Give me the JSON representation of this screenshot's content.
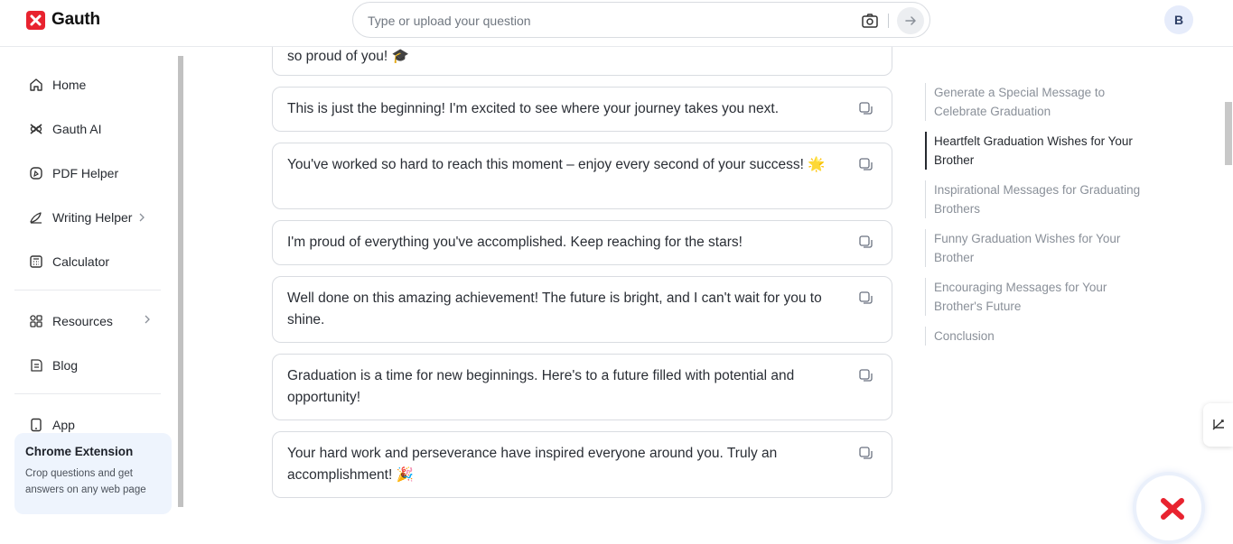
{
  "header": {
    "brand": "Gauth",
    "search_placeholder": "Type or upload your question",
    "avatar_initial": "B"
  },
  "sidebar": {
    "items": [
      {
        "label": "Home",
        "icon": "home-icon"
      },
      {
        "label": "Gauth AI",
        "icon": "gauth-ai-icon"
      },
      {
        "label": "PDF Helper",
        "icon": "pdf-icon"
      },
      {
        "label": "Writing Helper",
        "icon": "pen-icon"
      },
      {
        "label": "Calculator",
        "icon": "calculator-icon"
      },
      {
        "label": "Resources",
        "icon": "grid-icon"
      },
      {
        "label": "Blog",
        "icon": "blog-icon"
      },
      {
        "label": "App",
        "icon": "phone-icon"
      }
    ],
    "extension": {
      "title": "Chrome Extension",
      "description": "Crop questions and get answers on any web page"
    }
  },
  "messages": [
    {
      "text": "so proud of you! 🎓"
    },
    {
      "text": "This is just the beginning! I'm excited to see where your journey takes you next."
    },
    {
      "text": "You've worked so hard to reach this moment – enjoy every second of your success! 🌟"
    },
    {
      "text": "I'm proud of everything you've accomplished. Keep reaching for the stars!"
    },
    {
      "text": "Well done on this amazing achievement! The future is bright, and I can't wait for you to shine."
    },
    {
      "text": "Graduation is a time for new beginnings. Here's to a future filled with potential and opportunity!"
    },
    {
      "text": "Your hard work and perseverance have inspired everyone around you. Truly an accomplishment! 🎉"
    }
  ],
  "toc": [
    {
      "label": "Generate a Special Message to Celebrate Graduation",
      "active": false
    },
    {
      "label": "Heartfelt Graduation Wishes for Your Brother",
      "active": true
    },
    {
      "label": "Inspirational Messages for Graduating Brothers",
      "active": false
    },
    {
      "label": "Funny Graduation Wishes for Your Brother",
      "active": false
    },
    {
      "label": "Encouraging Messages for Your Brother's Future",
      "active": false
    },
    {
      "label": "Conclusion",
      "active": false
    }
  ],
  "colors": {
    "brand": "#e8232f",
    "active_toc": "#262a30",
    "card_border": "#d9dce1"
  }
}
